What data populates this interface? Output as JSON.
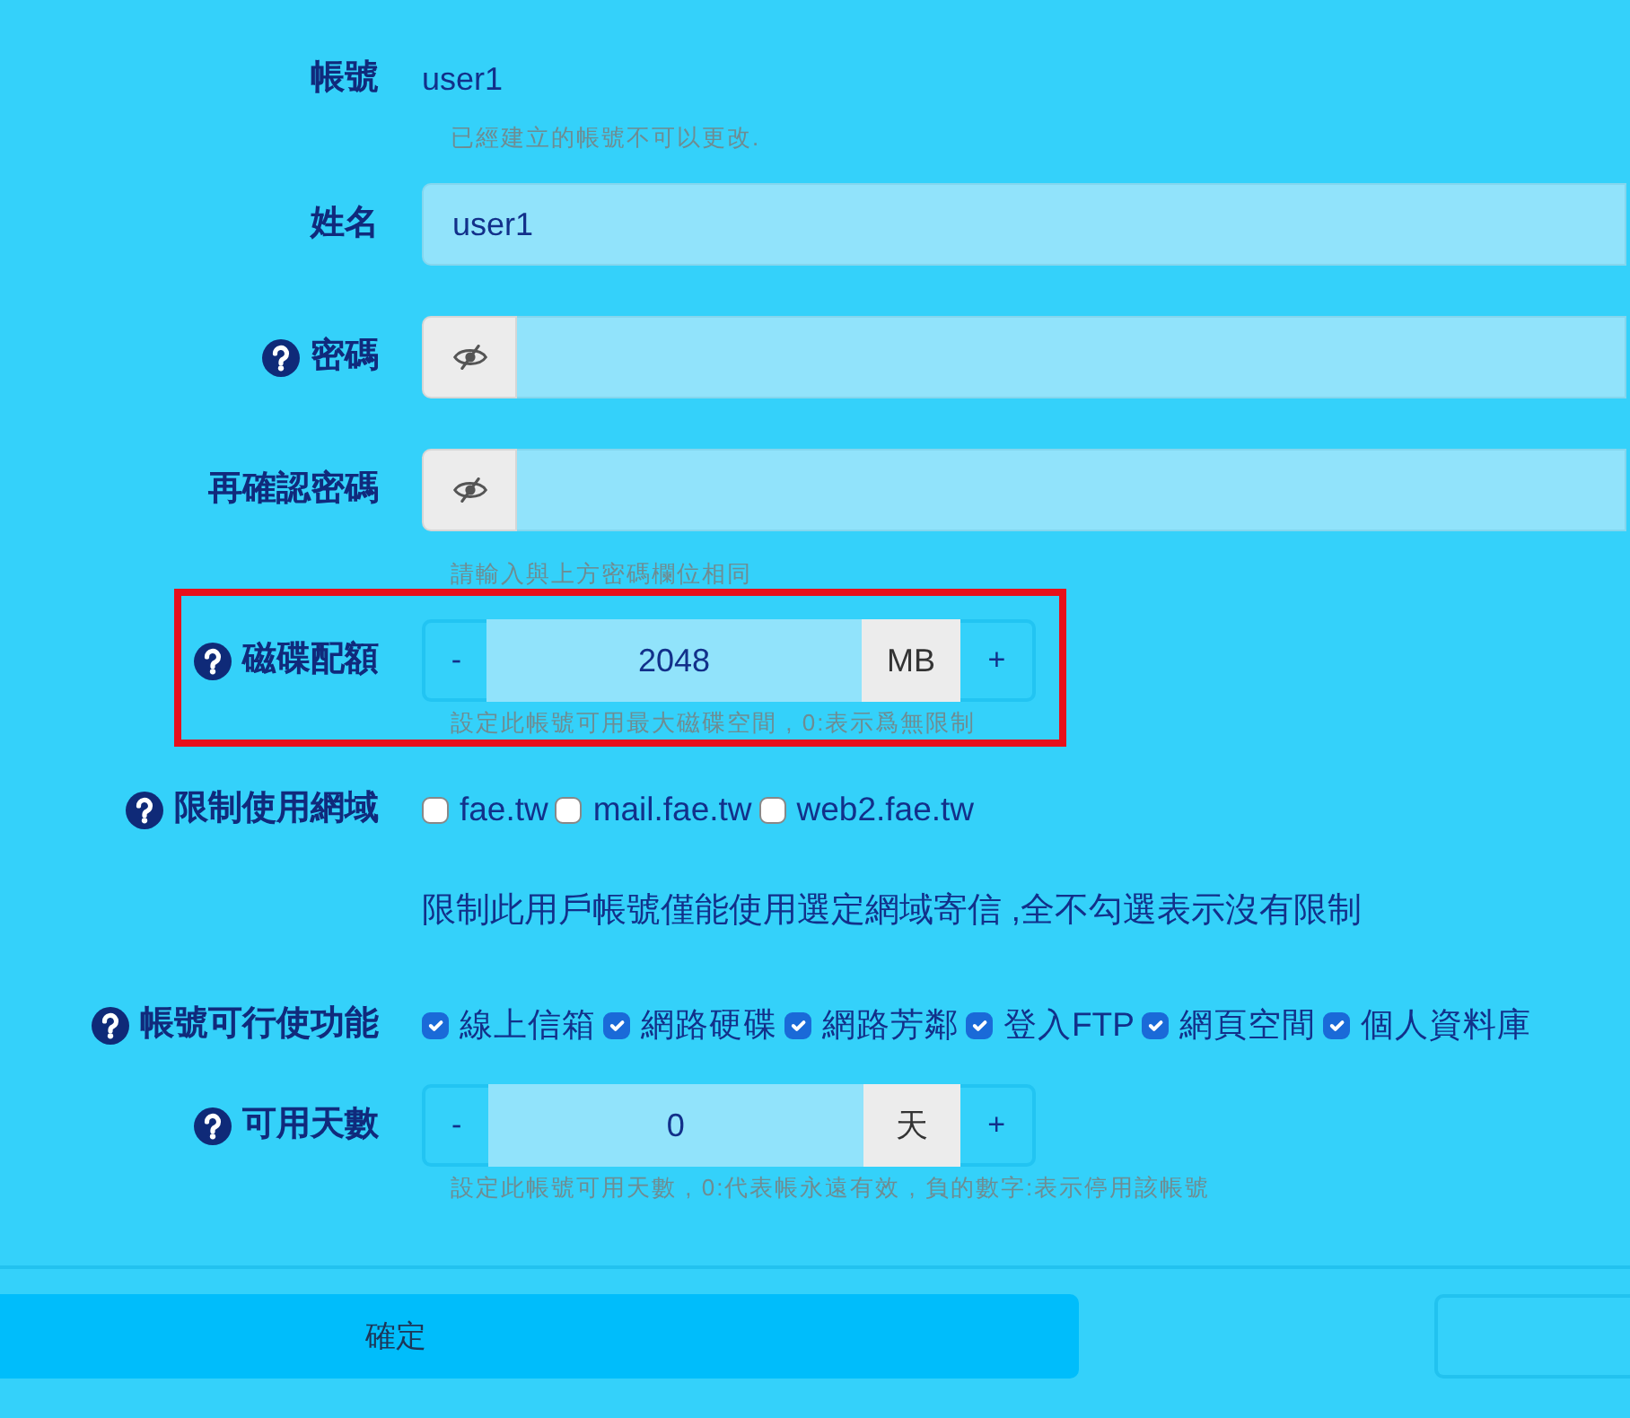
{
  "fields": [
    {
      "kind": "static",
      "label": "帳號",
      "help": false,
      "highlighted": false,
      "value": "user1",
      "hint": "已經建立的帳號不可以更改."
    },
    {
      "kind": "text",
      "label": "姓名",
      "help": false,
      "highlighted": false,
      "value": "user1"
    },
    {
      "kind": "password",
      "label": "密碼",
      "help": true,
      "highlighted": false
    },
    {
      "kind": "password",
      "label": "再確認密碼",
      "help": false,
      "highlighted": false,
      "hint": "請輸入與上方密碼欄位相同"
    },
    {
      "kind": "stepper",
      "label": "磁碟配額",
      "help": true,
      "highlighted": true,
      "minus": "-",
      "value": "2048",
      "unit": "MB",
      "plus": "+",
      "hint": "設定此帳號可用最大磁碟空間 , 0:表示爲無限制"
    },
    {
      "kind": "checkboxes",
      "label": "限制使用網域",
      "help": true,
      "highlighted": false,
      "options": [
        {
          "label": "fae.tw",
          "checked": false
        },
        {
          "label": "mail.fae.tw",
          "checked": false
        },
        {
          "label": "web2.fae.tw",
          "checked": false
        }
      ],
      "note": "限制此用戶帳號僅能使用選定網域寄信 ,全不勾選表示沒有限制"
    },
    {
      "kind": "checkboxes",
      "label": "帳號可行使功能",
      "help": true,
      "highlighted": false,
      "options": [
        {
          "label": "線上信箱",
          "checked": true
        },
        {
          "label": "網路硬碟",
          "checked": true
        },
        {
          "label": "網路芳鄰",
          "checked": true
        },
        {
          "label": "登入FTP",
          "checked": true
        },
        {
          "label": "網頁空間",
          "checked": true
        },
        {
          "label": "個人資料庫",
          "checked": true
        }
      ]
    },
    {
      "kind": "stepper",
      "label": "可用天數",
      "help": true,
      "highlighted": false,
      "minus": "-",
      "value": "0",
      "unit": "天",
      "plus": "+",
      "hint": "設定此帳號可用天數 , 0:代表帳永遠有效 , 負的數字:表示停用該帳號"
    }
  ],
  "footer": {
    "buttons": [
      {
        "kind": "primary",
        "label": "確定"
      },
      {
        "kind": "outline"
      }
    ]
  }
}
